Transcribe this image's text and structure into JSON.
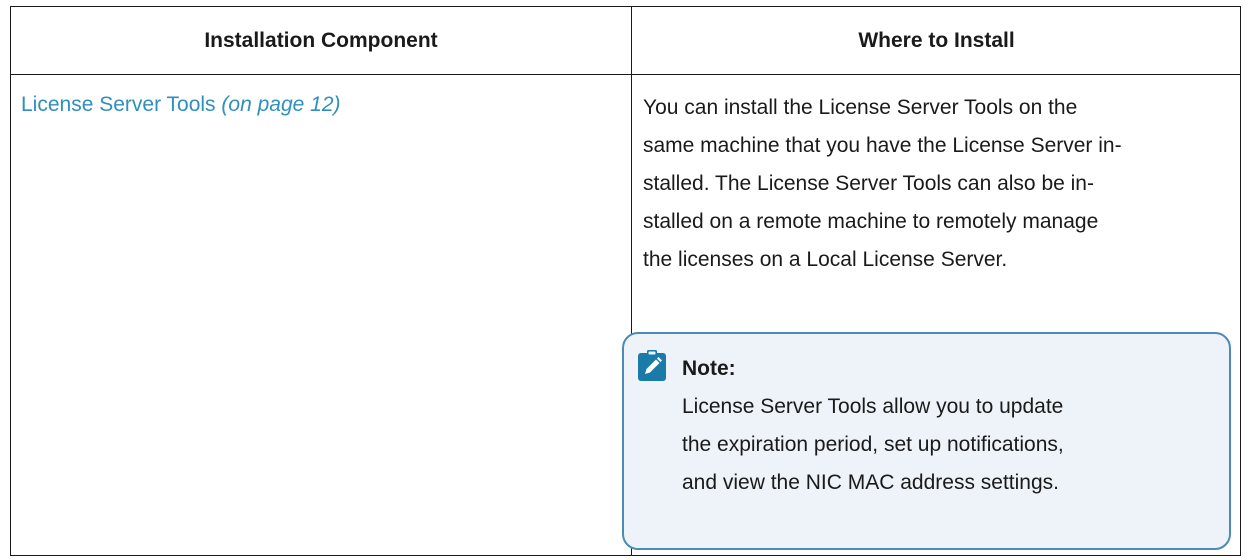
{
  "table": {
    "headers": [
      "Installation Component",
      "Where to Install"
    ],
    "rows": [
      {
        "component": {
          "link_text": "License Server Tools",
          "page_ref": "(on page 12)"
        },
        "where_lines": [
          "You can install the License Server Tools on the",
          "same machine that you have the License Server in-",
          "stalled. The License Server Tools can also be in-",
          "stalled on a remote machine to remotely manage",
          "the licenses on a Local License Server."
        ],
        "note": {
          "icon": "note-pencil-icon",
          "title": "Note:",
          "lines": [
            "License Server Tools allow you to update",
            "the expiration period, set up notifications,",
            "and view the NIC MAC address settings."
          ]
        }
      }
    ]
  },
  "colors": {
    "link": "#2f8fbd",
    "note_border": "#4c8bb3",
    "note_background": "#edf3f8",
    "note_icon": "#1a7aa8"
  }
}
